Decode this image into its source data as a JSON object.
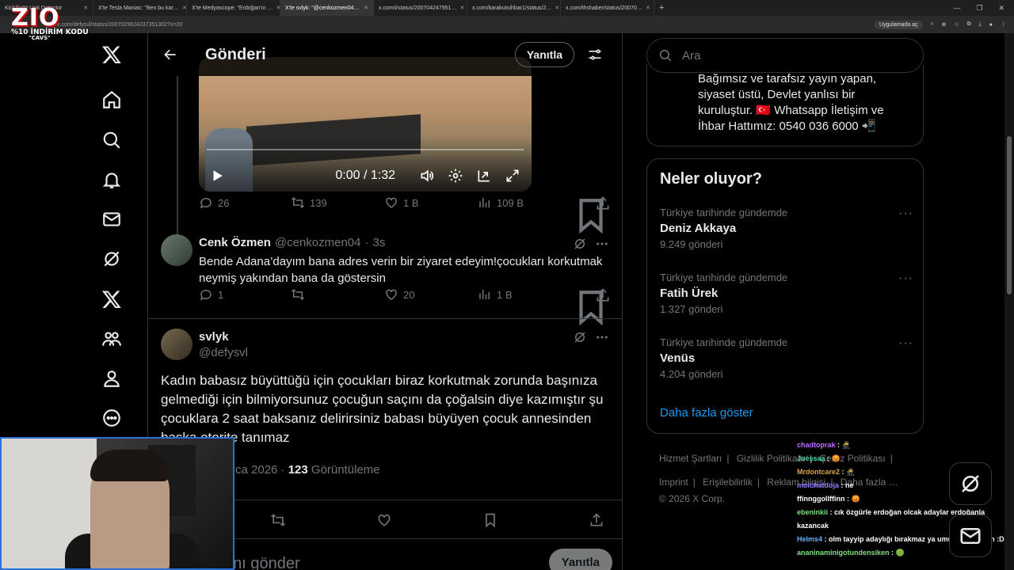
{
  "browser": {
    "tabs": [
      {
        "title": "KickSight Link Detector"
      },
      {
        "title": "X'te Tesla Maniac: \"Ben bu kar…"
      },
      {
        "title": "X'te Medyascope: \"Erdoğan'ın …"
      },
      {
        "title": "X'te svlyk: \"@cenkozmen04…"
      },
      {
        "title": "x.com/i/status/200704247951…"
      },
      {
        "title": "x.com/karakutuihbar1/status/2…"
      },
      {
        "title": "x.com/thshaber/status/20070…"
      }
    ],
    "new_tab": "+",
    "url": "x.com/defysvl/status/2007029624237351302?s=20",
    "open_in_app": "Uygulamada aç"
  },
  "overlay_logo": {
    "big": "ZIO",
    "small": "%10 İNDİRİM KODU",
    "small2": "\"CAVS\""
  },
  "header": {
    "title": "Gönderi",
    "reply_button": "Yanıtla"
  },
  "video": {
    "time": "0:00 / 1:32"
  },
  "video_actions": {
    "replies": "26",
    "reposts": "139",
    "likes": "1 B",
    "views": "109 B"
  },
  "reply": {
    "name": "Cenk Özmen",
    "handle": "@cenkozmen04",
    "time": "3s",
    "text": "Bende Adana’dayım bana adres verin bir ziyaret edeyim!çocukları korkutmak neymiş yakından bana da göstersin",
    "replies": "1",
    "likes": "20",
    "views": "1 B"
  },
  "main_tweet": {
    "name": "svlyk",
    "handle": "@defysvl",
    "text": "Kadın babasız büyüttüğü için çocukları biraz korkutmak zorunda başınıza gelmediği için bilmiyorsunuz çocuğun saçını da çoğalsin diye kazımıştır şu çocuklara 2 saat baksanız delirirsiniz babası büyüyen çocuk annesinden başka otorite tanımaz",
    "date": "ca 2026 · ",
    "views_count": "123",
    "views_label": " Görüntüleme",
    "compose_placeholder": "tını gönder",
    "compose_button": "Yanıtla"
  },
  "right": {
    "search_placeholder": "Ara",
    "bio": "Bağımsız ve tarafsız yayın yapan, siyaset üstü, Devlet yanlısı bir kuruluştur. 🇹🇷 Whatsapp İletişim ve İhbar Hattımız: 0540 036 6000 📲",
    "trends_title": "Neler oluyor?",
    "trends": [
      {
        "context": "Türkiye tarihinde gündemde",
        "name": "Deniz Akkaya",
        "count": "9.249 gönderi"
      },
      {
        "context": "Türkiye tarihinde gündemde",
        "name": "Fatih Ürek",
        "count": "1.327 gönderi"
      },
      {
        "context": "Türkiye tarihinde gündemde",
        "name": "Venüs",
        "count": "4.204 gönderi"
      }
    ],
    "show_more": "Daha fazla göster",
    "footer": {
      "terms": "Hizmet Şartları",
      "privacy": "Gizlilik Politikası",
      "cookies": "Çerez Politikası",
      "imprint": "Imprint",
      "accessibility": "Erişilebilirlik",
      "ads": "Reklam bilgisi",
      "more": "Daha fazla …",
      "copyright": "© 2026 X Corp."
    }
  },
  "chat": [
    {
      "user": "chadtoprak",
      "msg": ": 🥷",
      "color": "#c06bff"
    },
    {
      "user": "Juéşsaa",
      "msg": ": 😡",
      "color": "#55d3a0"
    },
    {
      "user": "Mrdontcare2",
      "msg": ": 🥷",
      "color": "#d9a14c"
    },
    {
      "user": "molchatdoja",
      "msg": ": ne",
      "color": "#9a7bff"
    },
    {
      "user": "ffinnggollffinn",
      "msg": ": 😡",
      "color": "#ffffff"
    },
    {
      "user": "ebeninkii",
      "msg": ": cık özgürle erdoğan olcak adaylar erdoğanla kazancak",
      "color": "#7ee07e"
    },
    {
      "user": "Helms4",
      "msg": ": olm tayyip adaylığı bırakmaz ya umutlandirmayın :D",
      "color": "#5fb4ff"
    },
    {
      "user": "ananinaminigotundensiken",
      "msg": ": 🟢",
      "color": "#7ee07e"
    }
  ]
}
